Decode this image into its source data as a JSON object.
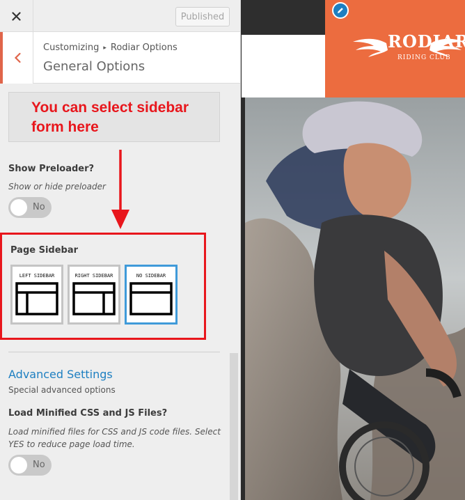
{
  "header": {
    "publish_label": "Published"
  },
  "section": {
    "breadcrumb_root": "Customizing",
    "breadcrumb_parent": "Rodiar Options",
    "title": "General Options"
  },
  "annotation": {
    "text": "You can select sidebar form here"
  },
  "preloader": {
    "label": "Show Preloader?",
    "description": "Show or hide preloader",
    "toggle_label": "No"
  },
  "page_sidebar": {
    "label": "Page Sidebar",
    "options": [
      {
        "label": "LEFT SIDEBAR"
      },
      {
        "label": "RIGHT SIDEBAR"
      },
      {
        "label": "NO SIDEBAR"
      }
    ],
    "selected": "NO SIDEBAR"
  },
  "advanced": {
    "title": "Advanced Settings",
    "subtitle": "Special advanced options"
  },
  "minified": {
    "label": "Load Minified CSS and JS Files?",
    "description": "Load minified files for CSS and JS code files. Select YES to reduce page load time.",
    "toggle_label": "No"
  },
  "preview": {
    "logo_title": "RODIAR",
    "logo_subtitle": "RIDING CLUB"
  },
  "colors": {
    "accent": "#e0654a",
    "annotation_red": "#e8161c",
    "link_blue": "#1d7fc1",
    "selected_border": "#3f9ad9",
    "logo_orange": "#ec6c3f"
  },
  "icons": [
    "close-icon",
    "chevron-left-icon",
    "pencil-icon",
    "wings-icon",
    "arrow-down-icon"
  ]
}
